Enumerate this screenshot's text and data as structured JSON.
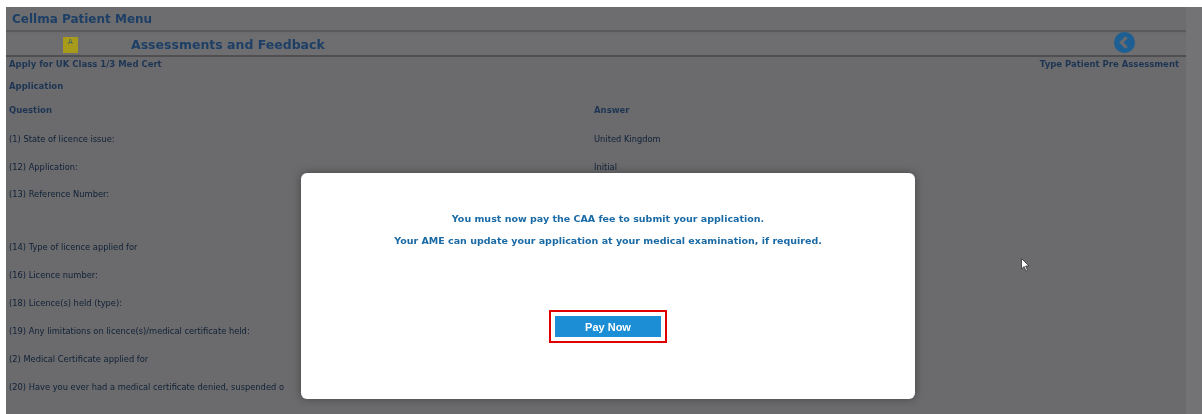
{
  "menu_title": "Cellma Patient Menu",
  "section": {
    "icon_letter": "A",
    "title": "Assessments and Feedback"
  },
  "breadcrumb": "Apply for UK Class 1/3 Med Cert",
  "page_type": "Type Patient Pre Assessment",
  "form_title": "Application",
  "columns": [
    "Question",
    "Answer"
  ],
  "rows": [
    {
      "question": "(1) State of licence issue:",
      "answer": "United Kingdom"
    },
    {
      "question": "(12) Application:",
      "answer": "Initial"
    },
    {
      "question": "(13) Reference Number:"
    },
    {
      "question": "(14) Type of licence applied for"
    },
    {
      "question": "(16) Licence number:"
    },
    {
      "question": "(18) Licence(s) held (type):"
    },
    {
      "question": "(19) Any limitations on licence(s)/medical certificate held:"
    },
    {
      "question": "(2) Medical Certificate applied for"
    },
    {
      "question": "(20) Have you ever had a medical certificate denied, suspended o"
    }
  ],
  "dialog": {
    "messages": [
      "You must now pay the CAA fee to submit your application.",
      "Your AME can update your application at your medical examination, if required."
    ],
    "button": "Pay Now",
    "button_highlighted": true
  }
}
